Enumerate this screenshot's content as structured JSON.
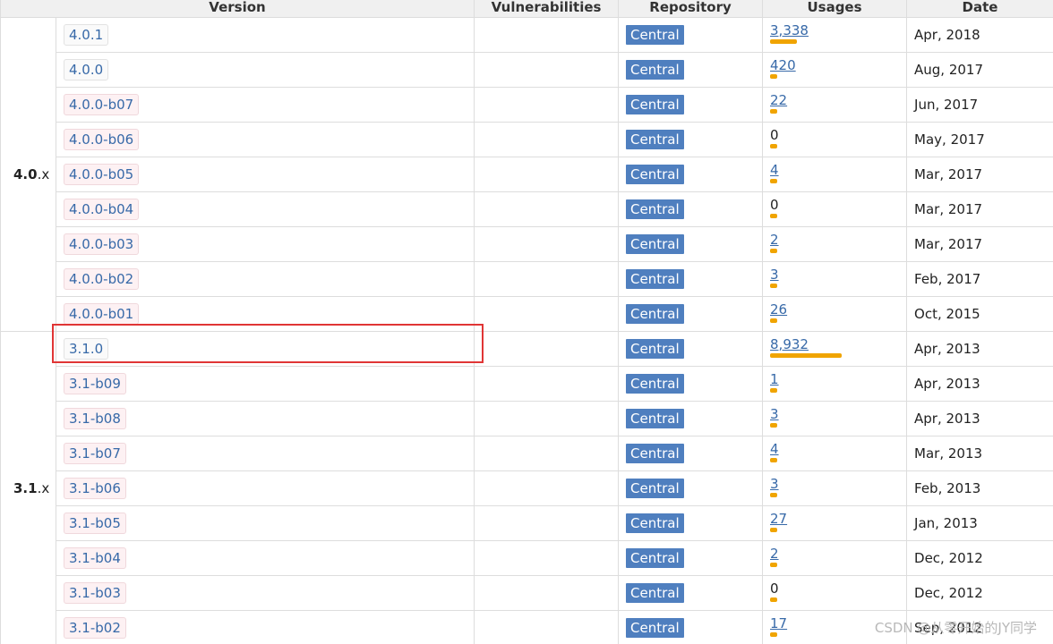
{
  "headers": {
    "version": "Version",
    "vulnerabilities": "Vulnerabilities",
    "repository": "Repository",
    "usages": "Usages",
    "date": "Date"
  },
  "groups": [
    {
      "major": "4.0",
      "suffix": ".x",
      "rows": [
        {
          "version": "4.0.1",
          "repo": "Central",
          "usages": "3,338",
          "date": "Apr, 2018",
          "release": true,
          "usage_fraction": 0.37
        },
        {
          "version": "4.0.0",
          "repo": "Central",
          "usages": "420",
          "date": "Aug, 2017",
          "release": true,
          "usage_fraction": 0.047
        },
        {
          "version": "4.0.0-b07",
          "repo": "Central",
          "usages": "22",
          "date": "Jun, 2017",
          "release": false,
          "usage_fraction": 0.002
        },
        {
          "version": "4.0.0-b06",
          "repo": "Central",
          "usages": "0",
          "date": "May, 2017",
          "release": false,
          "usage_fraction": 0
        },
        {
          "version": "4.0.0-b05",
          "repo": "Central",
          "usages": "4",
          "date": "Mar, 2017",
          "release": false,
          "usage_fraction": 0.0005
        },
        {
          "version": "4.0.0-b04",
          "repo": "Central",
          "usages": "0",
          "date": "Mar, 2017",
          "release": false,
          "usage_fraction": 0
        },
        {
          "version": "4.0.0-b03",
          "repo": "Central",
          "usages": "2",
          "date": "Mar, 2017",
          "release": false,
          "usage_fraction": 0.0002
        },
        {
          "version": "4.0.0-b02",
          "repo": "Central",
          "usages": "3",
          "date": "Feb, 2017",
          "release": false,
          "usage_fraction": 0.0003
        },
        {
          "version": "4.0.0-b01",
          "repo": "Central",
          "usages": "26",
          "date": "Oct, 2015",
          "release": false,
          "usage_fraction": 0.003
        }
      ]
    },
    {
      "major": "3.1",
      "suffix": ".x",
      "rows": [
        {
          "version": "3.1.0",
          "repo": "Central",
          "usages": "8,932",
          "date": "Apr, 2013",
          "release": true,
          "usage_fraction": 1.0
        },
        {
          "version": "3.1-b09",
          "repo": "Central",
          "usages": "1",
          "date": "Apr, 2013",
          "release": false,
          "usage_fraction": 0.0001
        },
        {
          "version": "3.1-b08",
          "repo": "Central",
          "usages": "3",
          "date": "Apr, 2013",
          "release": false,
          "usage_fraction": 0.0003
        },
        {
          "version": "3.1-b07",
          "repo": "Central",
          "usages": "4",
          "date": "Mar, 2013",
          "release": false,
          "usage_fraction": 0.0005
        },
        {
          "version": "3.1-b06",
          "repo": "Central",
          "usages": "3",
          "date": "Feb, 2013",
          "release": false,
          "usage_fraction": 0.0003
        },
        {
          "version": "3.1-b05",
          "repo": "Central",
          "usages": "27",
          "date": "Jan, 2013",
          "release": false,
          "usage_fraction": 0.003
        },
        {
          "version": "3.1-b04",
          "repo": "Central",
          "usages": "2",
          "date": "Dec, 2012",
          "release": false,
          "usage_fraction": 0.0002
        },
        {
          "version": "3.1-b03",
          "repo": "Central",
          "usages": "0",
          "date": "Dec, 2012",
          "release": false,
          "usage_fraction": 0
        },
        {
          "version": "3.1-b02",
          "repo": "Central",
          "usages": "17",
          "date": "Sep, 2012",
          "release": false,
          "usage_fraction": 0.002
        }
      ]
    }
  ],
  "colors": {
    "usage_bar": "#f0a400",
    "repo_badge": "#4f7fbf",
    "link": "#3769a8",
    "highlight": "#e03535"
  },
  "watermark": "CSDN @从零开始的JY同学"
}
